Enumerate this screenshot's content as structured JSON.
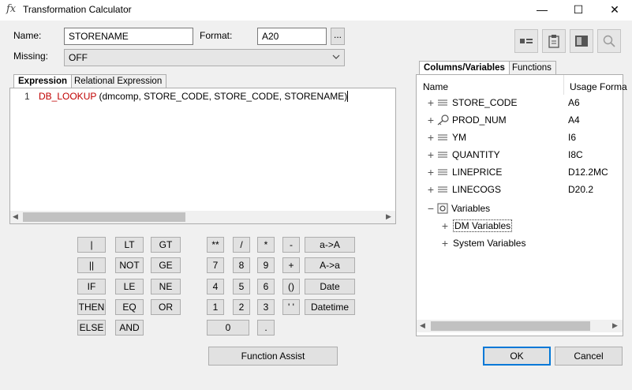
{
  "window": {
    "title": "Transformation Calculator",
    "icon": "fx-icon",
    "minimize": "—",
    "maximize": "☐",
    "close": "✕"
  },
  "form": {
    "name_label": "Name:",
    "name_value": "STORENAME",
    "format_label": "Format:",
    "format_value": "A20",
    "format_browse": "...",
    "missing_label": "Missing:",
    "missing_value": "OFF"
  },
  "tabs_left": [
    "Expression",
    "Relational Expression"
  ],
  "editor": {
    "line_number": "1",
    "func": "DB_LOOKUP",
    "args": " (dmcomp, STORE_CODE, STORE_CODE, STORENAME)"
  },
  "keypad": {
    "logic": [
      [
        "|",
        "LT",
        "GT"
      ],
      [
        "||",
        "NOT",
        "GE"
      ],
      [
        "IF",
        "LE",
        "NE"
      ],
      [
        "THEN",
        "EQ",
        "OR"
      ],
      [
        "ELSE",
        "AND"
      ]
    ],
    "math": [
      [
        "**",
        "/",
        "*",
        "-"
      ],
      [
        "7",
        "8",
        "9",
        "+"
      ],
      [
        "4",
        "5",
        "6",
        "()"
      ],
      [
        "1",
        "2",
        "3",
        "' '"
      ]
    ],
    "zero": "0",
    "dot": ".",
    "actions": [
      "a->A",
      "A->a",
      "Date",
      "Datetime"
    ],
    "function_assist": "Function Assist"
  },
  "tabs_right": [
    "Columns/Variables",
    "Functions"
  ],
  "tree": {
    "header_name": "Name",
    "header_usage": "Usage Forma",
    "columns": [
      {
        "name": "STORE_CODE",
        "usage": "A6",
        "icon": "field-list-icon"
      },
      {
        "name": "PROD_NUM",
        "usage": "A4",
        "icon": "key-icon"
      },
      {
        "name": "YM",
        "usage": "I6",
        "icon": "field-list-icon"
      },
      {
        "name": "QUANTITY",
        "usage": "I8C",
        "icon": "field-list-icon"
      },
      {
        "name": "LINEPRICE",
        "usage": "D12.2MC",
        "icon": "field-list-icon"
      },
      {
        "name": "LINECOGS",
        "usage": "D20.2",
        "icon": "field-list-icon"
      }
    ],
    "variables": "Variables",
    "dm_variables": "DM Variables",
    "system_variables": "System Variables"
  },
  "dialog": {
    "ok": "OK",
    "cancel": "Cancel"
  },
  "toolbar_icons": [
    "properties-icon",
    "clipboard-icon",
    "panel-icon",
    "search-icon"
  ]
}
